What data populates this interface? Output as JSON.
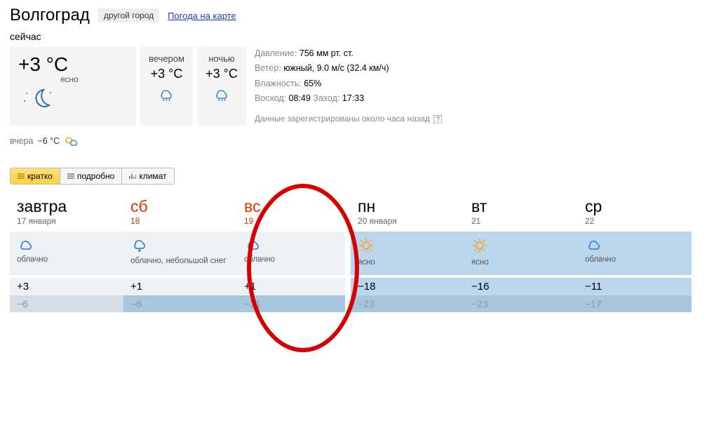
{
  "header": {
    "city": "Волгоград",
    "other_city_btn": "другой город",
    "map_link": "Погода на карте"
  },
  "now": {
    "label": "сейчас",
    "temp": "+3 °C",
    "condition": "ясно",
    "parts": [
      {
        "title": "вечером",
        "temp": "+3 °C",
        "icon": "rain"
      },
      {
        "title": "ночью",
        "temp": "+3 °C",
        "icon": "rain"
      }
    ]
  },
  "details": {
    "pressure_label": "Давление:",
    "pressure_value": "756 мм рт. ст.",
    "wind_label": "Ветер:",
    "wind_value": "южный, 9.0 м/с (32.4 км/ч)",
    "humidity_label": "Влажность:",
    "humidity_value": "65%",
    "sunrise_label": "Восход:",
    "sunrise_value": "08:49",
    "sunset_label": "Заход:",
    "sunset_value": "17:33",
    "data_note": "Данные зарегистрированы около часа назад"
  },
  "yesterday": {
    "label": "вчера",
    "value": "−6 °C"
  },
  "tabs": {
    "brief": "кратко",
    "detailed": "подробно",
    "climate": "климат"
  },
  "forecast": [
    {
      "dow": "завтра",
      "date": "17 января",
      "red": false,
      "icon": "cloud",
      "cond": "облачно",
      "hi": "+3",
      "lo": "−6",
      "blue": false
    },
    {
      "dow": "сб",
      "date": "18",
      "red": true,
      "icon": "snowcloud",
      "cond": "облачно, небольшой снег",
      "hi": "+1",
      "lo": "−6",
      "blue": false
    },
    {
      "dow": "вс",
      "date": "19",
      "red": true,
      "icon": "cloud",
      "cond": "облачно",
      "hi": "+1",
      "lo": "−21",
      "blue": false
    },
    {
      "dow": "пн",
      "date": "20 января",
      "red": false,
      "icon": "sun",
      "cond": "ясно",
      "hi": "−18",
      "lo": "−23",
      "blue": true,
      "gap": true
    },
    {
      "dow": "вт",
      "date": "21",
      "red": false,
      "icon": "sun",
      "cond": "ясно",
      "hi": "−16",
      "lo": "−23",
      "blue": true
    },
    {
      "dow": "ср",
      "date": "22",
      "red": false,
      "icon": "cloud",
      "cond": "облачно",
      "hi": "−11",
      "lo": "−17",
      "blue": true
    }
  ]
}
